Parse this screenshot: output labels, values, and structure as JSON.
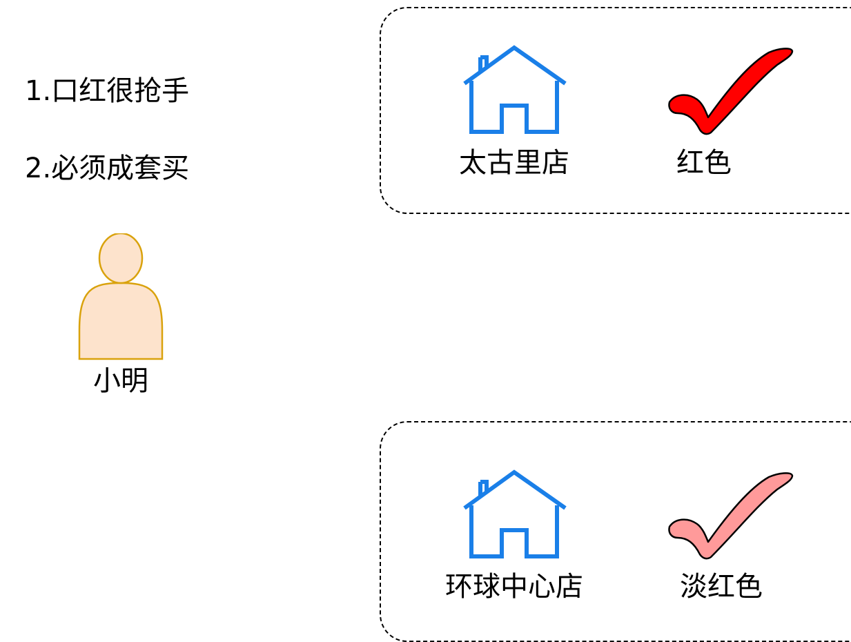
{
  "notes": {
    "first": "1.口红很抢手",
    "second": "2.必须成套买"
  },
  "person": {
    "name": "小明",
    "icon": "person-icon",
    "fill": "#fde3cc",
    "stroke": "#d9a20c"
  },
  "stores": [
    {
      "store_name": "太古里店",
      "color_label": "红色",
      "store_icon": "house-icon",
      "check_icon": "checkmark-icon",
      "check_color": "#ff0000"
    },
    {
      "store_name": "环球中心店",
      "color_label": "淡红色",
      "store_icon": "house-icon",
      "check_icon": "checkmark-icon",
      "check_color": "#ff9a9a"
    }
  ],
  "colors": {
    "house_blue": "#1a7fe8",
    "dash_border": "#000000"
  }
}
